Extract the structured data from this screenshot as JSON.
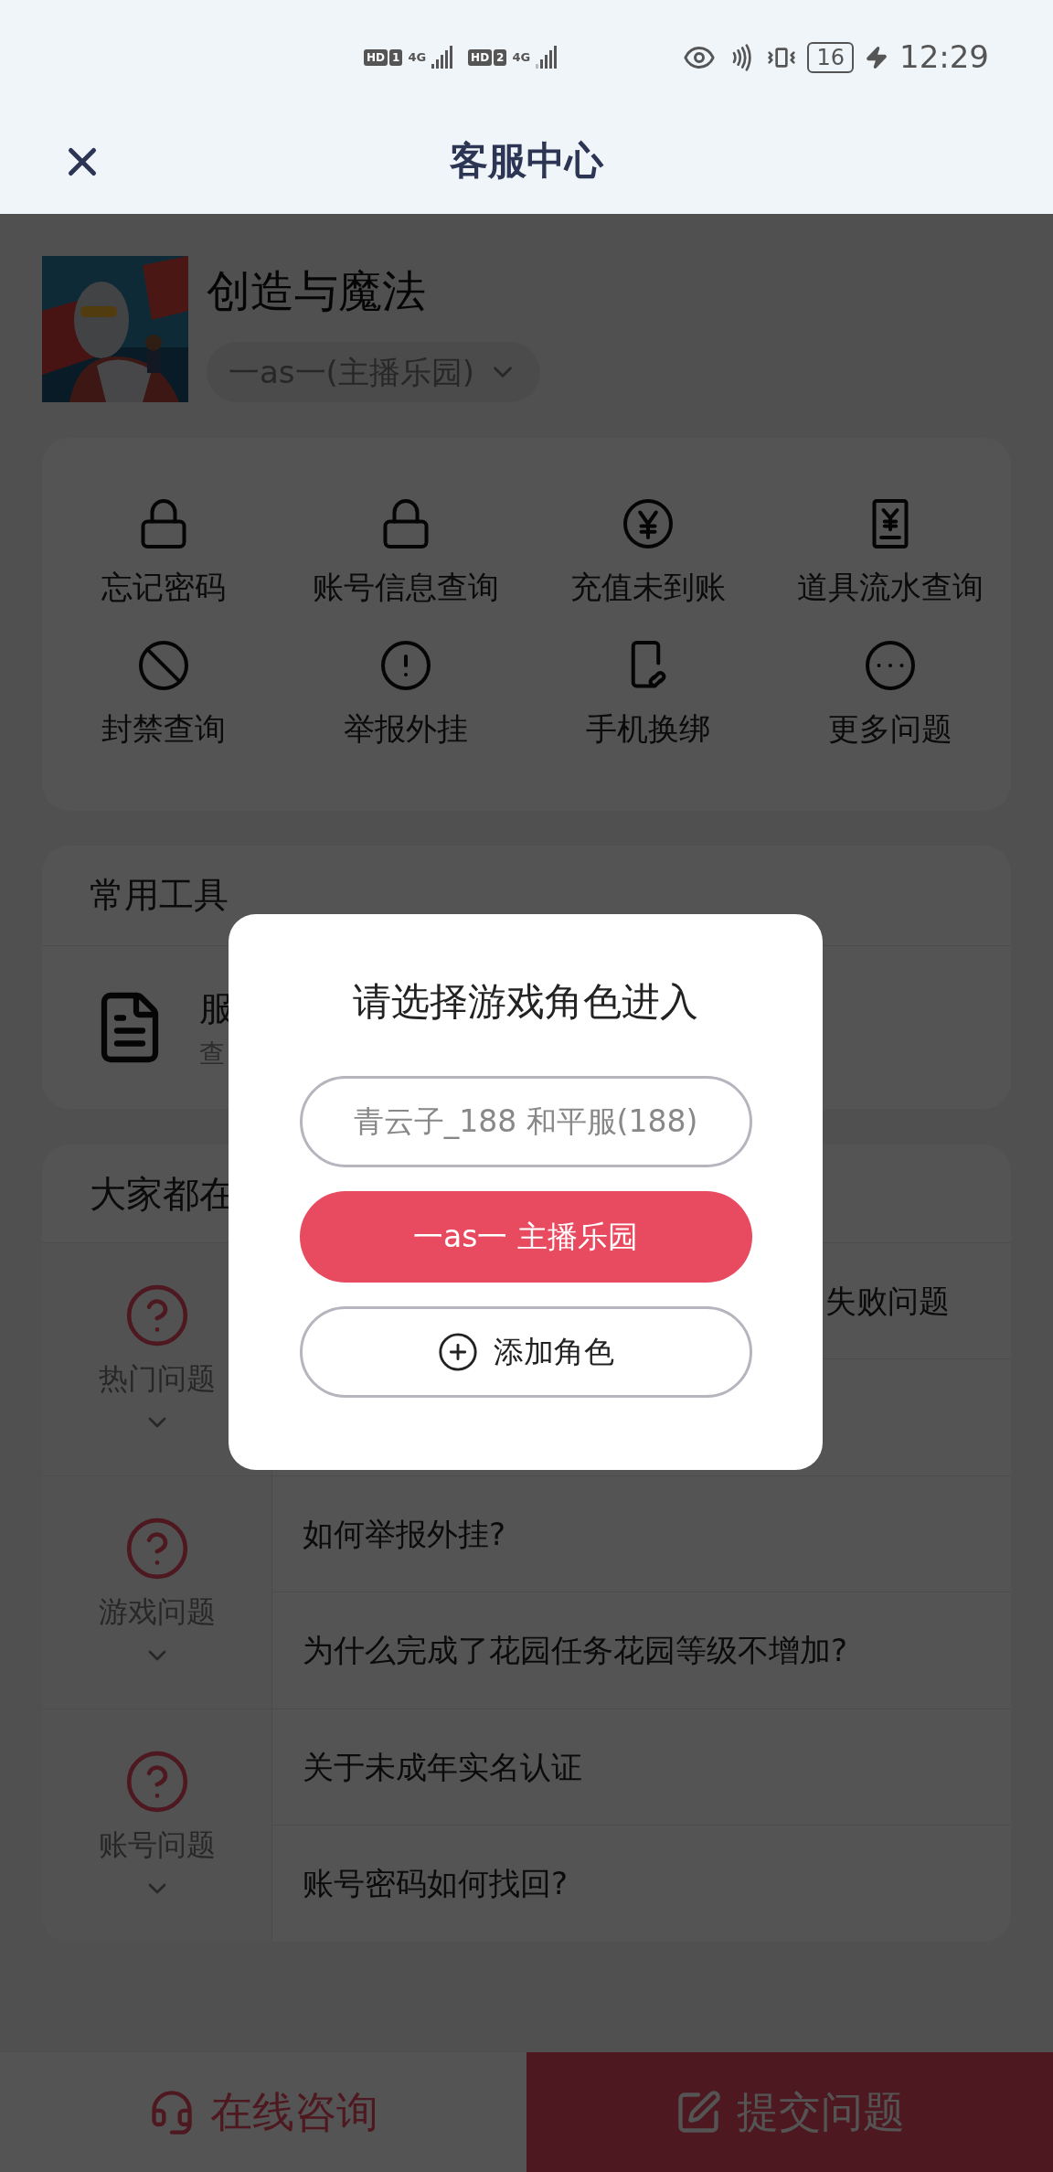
{
  "status_bar": {
    "sims": [
      {
        "hd": "HD",
        "slot": "1",
        "net": "4G"
      },
      {
        "hd": "HD",
        "slot": "2",
        "net": "4G"
      }
    ],
    "battery": "16",
    "time": "12:29"
  },
  "header": {
    "title": "客服中心"
  },
  "game": {
    "title": "创造与魔法",
    "role": "一as一(主播乐园)"
  },
  "shortcuts": [
    {
      "label": "忘记密码"
    },
    {
      "label": "账号信息查询"
    },
    {
      "label": "充值未到账"
    },
    {
      "label": "道具流水查询"
    },
    {
      "label": "封禁查询"
    },
    {
      "label": "举报外挂"
    },
    {
      "label": "手机换绑"
    },
    {
      "label": "更多问题"
    }
  ],
  "tools": {
    "title": "常用工具",
    "items": [
      {
        "title": "服",
        "subtitle": "查"
      }
    ]
  },
  "faq": {
    "title": "大家都在",
    "categories": [
      {
        "label": "热门问题",
        "expanded": true,
        "questions": [
          {
            "kind": "cut",
            "text": "失败问题"
          },
          {
            "kind": "covered"
          }
        ]
      },
      {
        "label": "游戏问题",
        "expanded": true,
        "questions": [
          {
            "kind": "text",
            "text": "如何举报外挂?"
          },
          {
            "kind": "text",
            "text": "为什么完成了花园任务花园等级不增加?"
          }
        ]
      },
      {
        "label": "账号问题",
        "expanded": true,
        "questions": [
          {
            "kind": "text",
            "text": "关于未成年实名认证"
          },
          {
            "kind": "text",
            "text": "账号密码如何找回?"
          }
        ]
      }
    ]
  },
  "bottom_bar": [
    {
      "label": "在线咨询",
      "kind": "secondary"
    },
    {
      "label": "提交问题",
      "kind": "primary"
    }
  ],
  "dialog": {
    "title": "请选择游戏角色进入",
    "options": [
      {
        "kind": "role",
        "label": "青云子_188 和平服(188)",
        "selected": false
      },
      {
        "kind": "role",
        "label": "一as一 主播乐园",
        "selected": true
      },
      {
        "kind": "add",
        "label": "添加角色"
      }
    ]
  }
}
